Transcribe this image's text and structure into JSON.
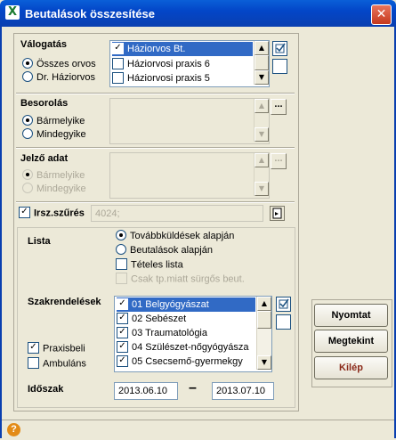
{
  "window": {
    "title": "Beutalások összesítése",
    "close_glyph": "✕",
    "app_icon": "X"
  },
  "valogatas": {
    "label": "Válogatás",
    "options": [
      "Összes orvos",
      "Dr. Háziorvos"
    ],
    "selected": 0,
    "list": [
      {
        "label": "Háziorvos Bt.",
        "checked": true,
        "selected": true
      },
      {
        "label": "Háziorvosi praxis 6",
        "checked": false,
        "selected": false
      },
      {
        "label": "Háziorvosi praxis 5",
        "checked": false,
        "selected": false
      }
    ]
  },
  "besorolas": {
    "label": "Besorolás",
    "options": [
      "Bármelyike",
      "Mindegyike"
    ],
    "selected": 0,
    "dots": "..."
  },
  "jelzo": {
    "label": "Jelző adat",
    "options": [
      "Bármelyike",
      "Mindegyike"
    ],
    "selected": 0,
    "dots": "..."
  },
  "irsz": {
    "label": "Irsz.szűrés",
    "checked": true,
    "value": "4024;"
  },
  "lista": {
    "label": "Lista",
    "options": [
      "Továbbküldések alapján",
      "Beutalások alapján"
    ],
    "selected": 0,
    "checkboxes": [
      {
        "label": "Tételes lista",
        "checked": false,
        "disabled": false
      },
      {
        "label": "Csak tp.miatt sürgős beut.",
        "checked": false,
        "disabled": true
      }
    ]
  },
  "szakrend": {
    "label": "Szakrendelések",
    "list": [
      {
        "label": "01 Belgyógyászat",
        "checked": true,
        "selected": true
      },
      {
        "label": "02 Sebészet",
        "checked": true,
        "selected": false
      },
      {
        "label": "03 Traumatológia",
        "checked": true,
        "selected": false
      },
      {
        "label": "04 Szülészet-nőgyógyásza",
        "checked": true,
        "selected": false
      },
      {
        "label": "05 Csecsemő-gyermekgy",
        "checked": true,
        "selected": false
      }
    ]
  },
  "praxis": {
    "praxisbeli": "Praxisbeli",
    "praxisbeli_checked": true,
    "ambulans": "Ambuláns",
    "ambulans_checked": false
  },
  "idoszak": {
    "label": "Időszak",
    "from": "2013.06.10",
    "to": "2013.07.10",
    "dash": "–"
  },
  "buttons": {
    "nyomtat": "Nyomtat",
    "megtekint": "Megtekint",
    "kilep": "Kilép",
    "kilep_color": "#8b2a1a"
  },
  "status": {
    "help_glyph": "?"
  },
  "colors": {
    "titlebar": "#0346c8",
    "selection": "#316ac5",
    "body": "#ece9d8"
  }
}
